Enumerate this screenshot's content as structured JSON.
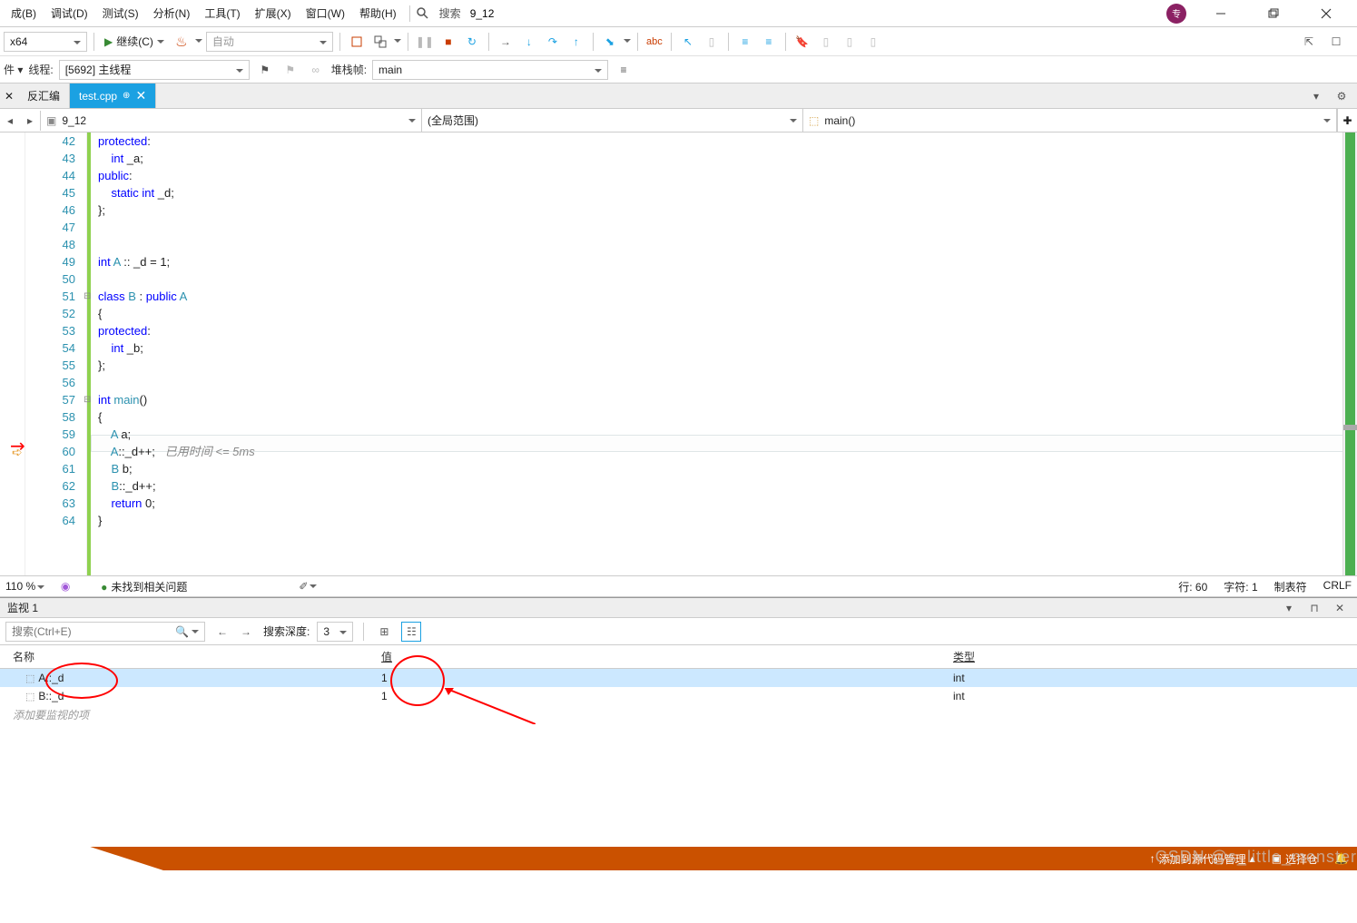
{
  "menu": {
    "items": [
      "成(B)",
      "调试(D)",
      "测试(S)",
      "分析(N)",
      "工具(T)",
      "扩展(X)",
      "窗口(W)",
      "帮助(H)"
    ],
    "search_label": "搜索",
    "solution_name": "9_12"
  },
  "toolbar": {
    "platform": "x64",
    "continue_label": "继续(C)",
    "auto_label": "自动"
  },
  "toolbar2": {
    "process_label": "件 ▾",
    "thread_label": "线程:",
    "thread_value": "[5692] 主线程",
    "stack_frame_label": "堆栈帧:",
    "stack_frame_value": "main"
  },
  "tabs": {
    "tab1": "反汇编",
    "tab2": "test.cpp"
  },
  "navbar": {
    "scope1": "9_12",
    "scope2": "(全局范围)",
    "scope3": "main()"
  },
  "code_lines": [
    {
      "n": 42,
      "html": "<span class='kw'>protected</span>:"
    },
    {
      "n": 43,
      "html": "    <span class='kw'>int</span> _a;"
    },
    {
      "n": 44,
      "html": "<span class='kw'>public</span>:"
    },
    {
      "n": 45,
      "html": "    <span class='kw'>static</span> <span class='kw'>int</span> _d;"
    },
    {
      "n": 46,
      "html": "};"
    },
    {
      "n": 47,
      "html": ""
    },
    {
      "n": 48,
      "html": ""
    },
    {
      "n": 49,
      "html": "<span class='kw'>int</span> <span class='type'>A</span> :: _d = 1;"
    },
    {
      "n": 50,
      "html": ""
    },
    {
      "n": 51,
      "html": "<span class='kw'>class</span> <span class='type'>B</span> : <span class='kw'>public</span> <span class='type'>A</span>",
      "collapse": true
    },
    {
      "n": 52,
      "html": "{"
    },
    {
      "n": 53,
      "html": "<span class='kw'>protected</span>:"
    },
    {
      "n": 54,
      "html": "    <span class='kw'>int</span> _b;"
    },
    {
      "n": 55,
      "html": "};"
    },
    {
      "n": 56,
      "html": ""
    },
    {
      "n": 57,
      "html": "<span class='kw'>int</span> <span class='type'>main</span>()",
      "collapse": true
    },
    {
      "n": 58,
      "html": "{"
    },
    {
      "n": 59,
      "html": "    <span class='type'>A</span> a;"
    },
    {
      "n": 60,
      "html": "    <span class='type'>A</span>::_d++;   <span class='comment'>已用时间 &lt;= 5ms</span>",
      "current": true
    },
    {
      "n": 61,
      "html": "    <span class='type'>B</span> b;"
    },
    {
      "n": 62,
      "html": "    <span class='type'>B</span>::_d++;"
    },
    {
      "n": 63,
      "html": "    <span class='kw'>return</span> 0;"
    },
    {
      "n": 64,
      "html": "}"
    }
  ],
  "editor_status": {
    "zoom": "110 %",
    "issues": "未找到相关问题",
    "line": "行: 60",
    "char": "字符: 1",
    "tabs": "制表符",
    "encoding": "CRLF"
  },
  "watch": {
    "title": "监视 1",
    "search_placeholder": "搜索(Ctrl+E)",
    "depth_label": "搜索深度:",
    "depth_value": "3",
    "col_name": "名称",
    "col_val": "值",
    "col_type": "类型",
    "rows": [
      {
        "name": "A::_d",
        "value": "1",
        "type": "int"
      },
      {
        "name": "B::_d",
        "value": "1",
        "type": "int"
      }
    ],
    "placeholder": "添加要监视的项"
  },
  "statusbar": {
    "add_scc": "添加到源代码管理",
    "select": "选择仓"
  },
  "watermark": "CSDN @s_little_monster"
}
